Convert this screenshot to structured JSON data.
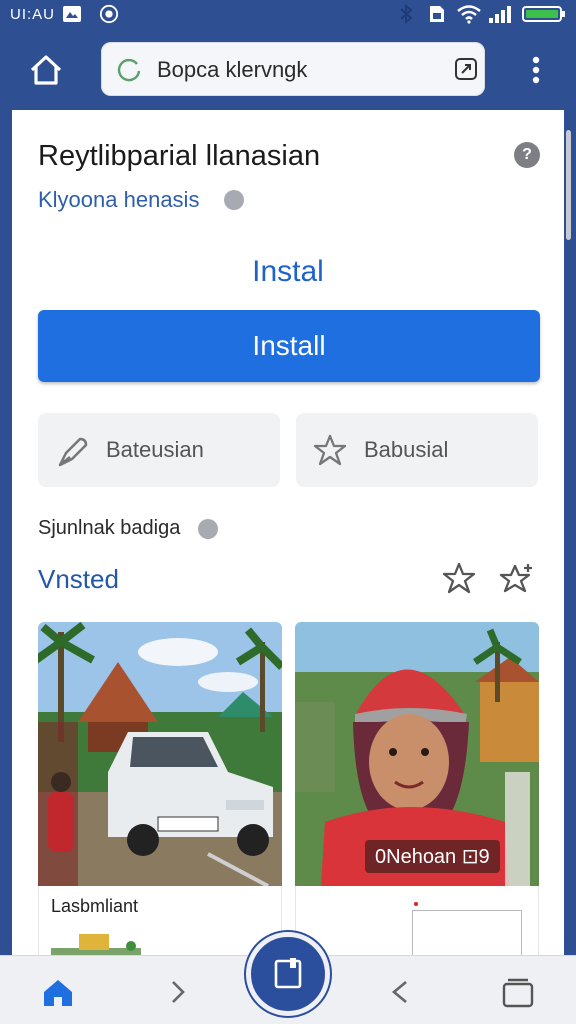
{
  "status_bar": {
    "time": "UI:AU",
    "icons": [
      "photo-icon",
      "whatsapp-icon",
      "bluetooth-icon",
      "sim-icon",
      "wifi-icon",
      "signal-icon",
      "battery-icon"
    ]
  },
  "browser": {
    "url_text": "Bopca klervngk",
    "icons": [
      "home-icon",
      "reload-icon",
      "tab-switch-icon",
      "overflow-menu-icon"
    ]
  },
  "app": {
    "title": "Reytlibparial llanasian",
    "subtitle": "Klyoona henasis",
    "install_heading": "Instal",
    "install_button": "Install",
    "action_1": "Bateusian",
    "action_2": "Babusial",
    "related_label": "Sjunlnak badiga"
  },
  "section": {
    "title": "Vnsted",
    "photos": [
      {
        "overlay": ""
      },
      {
        "overlay": "0Nehoan ⊡9"
      }
    ],
    "caption_1": "Lasbmliant"
  },
  "bottom_nav": {
    "icons": [
      "home-icon",
      "forward-icon",
      "center-tab-icon",
      "back-icon",
      "tabs-icon"
    ]
  },
  "colors": {
    "header_blue": "#2f4f93",
    "install_blue": "#1f6fe0",
    "link_blue": "#2f5faa"
  }
}
